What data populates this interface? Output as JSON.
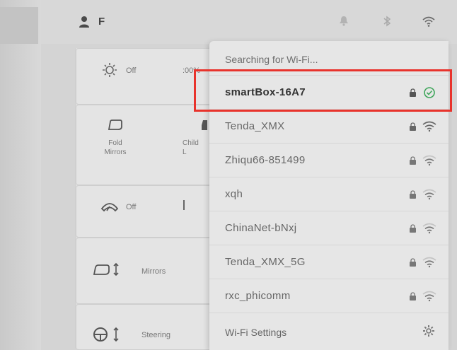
{
  "topbar": {
    "user_initial": "F",
    "icons": [
      "user-icon",
      "bell-icon",
      "bluetooth-icon",
      "wifi-icon"
    ]
  },
  "controls": {
    "headlights_label": "Off",
    "headlights_partial": ":00%",
    "fold_mirrors_label": "Fold\nMirrors",
    "child_lock_partial": "Child\nL",
    "wipers_label": "Off",
    "mirrors_label": "Mirrors",
    "steering_label": "Steering"
  },
  "wifi": {
    "header": "Searching for Wi-Fi...",
    "networks": [
      {
        "name": "smartBox-16A7",
        "secured": true,
        "status": "connected",
        "signal": 1.0
      },
      {
        "name": "Tenda_XMX",
        "secured": true,
        "status": "available",
        "signal": 1.0
      },
      {
        "name": "Zhiqu66-851499",
        "secured": true,
        "status": "available",
        "signal": 0.5
      },
      {
        "name": "xqh",
        "secured": true,
        "status": "available",
        "signal": 0.5
      },
      {
        "name": "ChinaNet-bNxj",
        "secured": true,
        "status": "available",
        "signal": 0.5
      },
      {
        "name": "Tenda_XMX_5G",
        "secured": true,
        "status": "available",
        "signal": 0.5
      },
      {
        "name": "rxc_phicomm",
        "secured": true,
        "status": "available",
        "signal": 0.5
      }
    ],
    "settings_label": "Wi-Fi Settings"
  },
  "colors": {
    "highlight": "#e8332c",
    "connected_check": "#3ea55a",
    "panel_bg": "#e6e6e6"
  }
}
